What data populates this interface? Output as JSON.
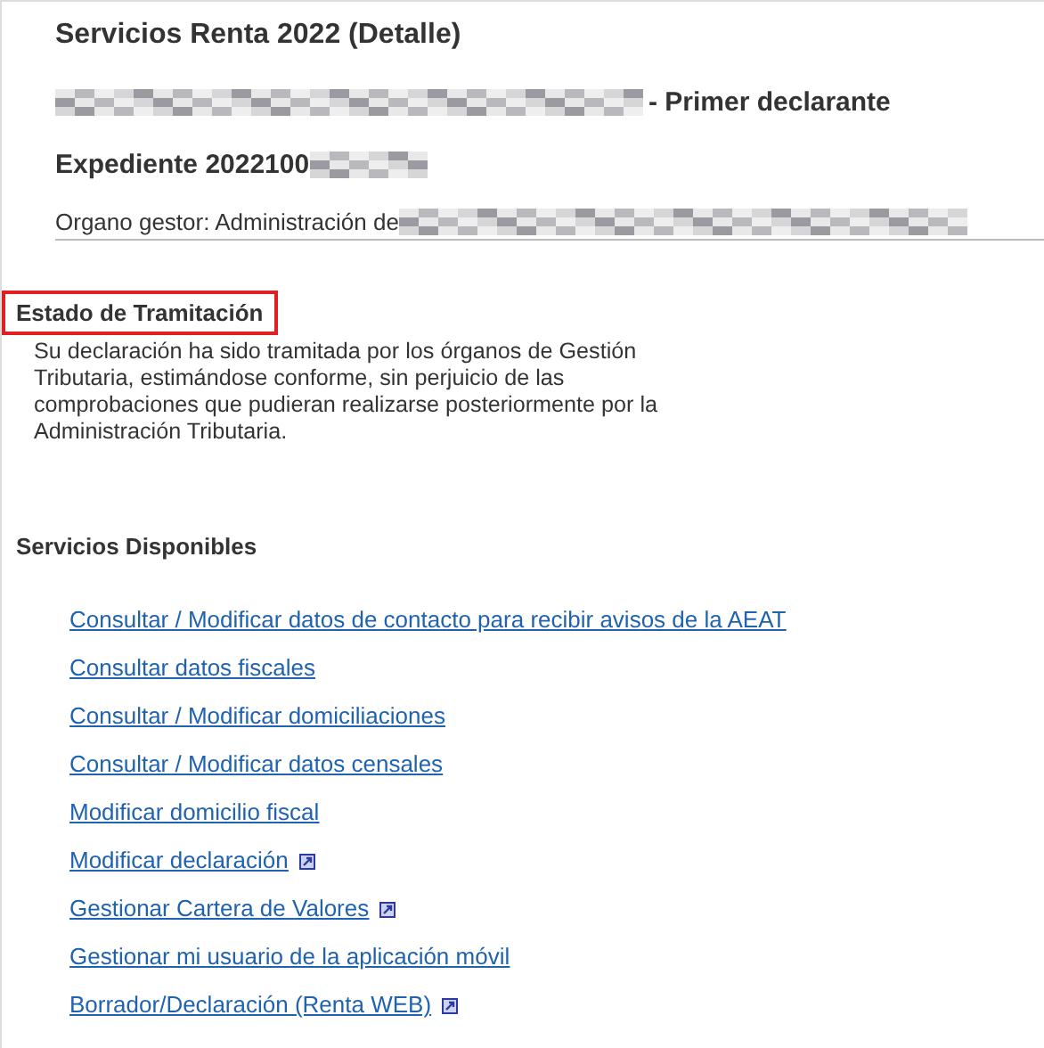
{
  "header": {
    "title": "Servicios Renta 2022 (Detalle)",
    "declarant_suffix": "- Primer declarante",
    "file_label": "Expediente 2022100",
    "office_label": "Organo gestor: Administración de"
  },
  "status": {
    "heading": "Estado de Tramitación",
    "highlighted": true,
    "message": "Su declaración ha sido tramitada por los órganos de Gestión Tributaria, estimándose conforme, sin perjuicio de las comprobaciones que pudieran realizarse posteriormente por la Administración Tributaria."
  },
  "services": {
    "heading": "Servicios Disponibles",
    "links": [
      {
        "label": "Consultar / Modificar datos de contacto para recibir avisos de la AEAT",
        "external": false
      },
      {
        "label": "Consultar datos fiscales",
        "external": false
      },
      {
        "label": "Consultar / Modificar domiciliaciones",
        "external": false
      },
      {
        "label": "Consultar / Modificar datos censales",
        "external": false
      },
      {
        "label": "Modificar domicilio fiscal",
        "external": false
      },
      {
        "label": "Modificar declaración",
        "external": true
      },
      {
        "label": "Gestionar Cartera de Valores",
        "external": true
      },
      {
        "label": "Gestionar mi usuario de la aplicación móvil",
        "external": false
      },
      {
        "label": "Borrador/Declaración (Renta WEB)",
        "external": true
      }
    ]
  }
}
